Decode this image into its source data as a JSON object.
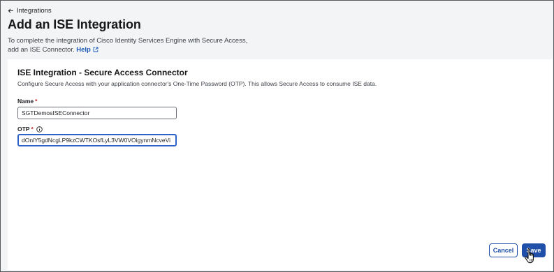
{
  "breadcrumb": {
    "label": "Integrations"
  },
  "page": {
    "title": "Add an ISE Integration",
    "description": "To complete the integration of Cisco Identity Services Engine with Secure Access, add an ISE Connector.",
    "help_label": "Help"
  },
  "card": {
    "title": "ISE Integration - Secure Access Connector",
    "description": "Configure Secure Access with your application connector's One-Time Password (OTP). This allows Secure Access to consume ISE data."
  },
  "form": {
    "name": {
      "label": "Name",
      "required_mark": "*",
      "value": "SGTDemosISEConnector"
    },
    "otp": {
      "label": "OTP",
      "required_mark": "*",
      "value": "dOnlY5gdNcgLP9kzCWTKOsfLyL3VW0VOigynmNcveVi"
    }
  },
  "actions": {
    "cancel_label": "Cancel",
    "save_label": "Save"
  },
  "colors": {
    "accent": "#1f4fa8",
    "focus": "#2d62c9",
    "required": "#c0262d",
    "link": "#1f58b8"
  },
  "icons": [
    "arrow-left-icon",
    "external-link-icon",
    "info-icon",
    "hand-pointer-cursor-icon"
  ]
}
